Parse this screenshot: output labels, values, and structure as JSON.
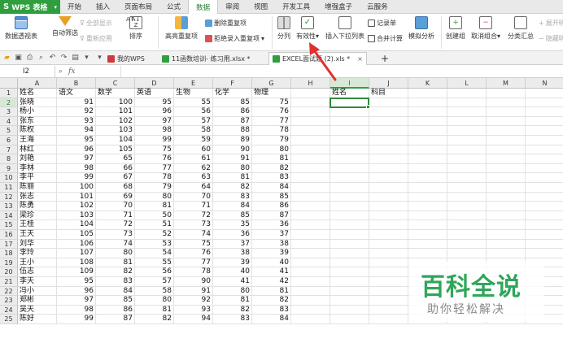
{
  "menubar": {
    "app_label": "WPS 表格",
    "tabs": [
      "开始",
      "插入",
      "页面布局",
      "公式",
      "数据",
      "审阅",
      "视图",
      "开发工具",
      "增强盒子",
      "云服务"
    ],
    "active_tab": "数据"
  },
  "ribbon": {
    "pivot": "数据透视表",
    "autofilter": "自动筛选",
    "show_all": "全部显示",
    "reapply": "重新应用",
    "sort": "排序",
    "highlight_dup": "高亮重复项",
    "delete_dup": "删除重复项",
    "reject_dup": "拒绝录入重复项",
    "split": "分列",
    "validity": "有效性",
    "insert_dropdown": "插入下拉列表",
    "record": "记录单",
    "merge_calc": "合并计算",
    "simulate": "模拟分析",
    "group": "创建组",
    "ungroup": "取消组合",
    "subtotal": "分类汇总",
    "show_detail": "展开明细",
    "hide_detail": "隐藏明细"
  },
  "doc_tabs": {
    "tabs": [
      {
        "label": "我的WPS",
        "closable": false
      },
      {
        "label": "11函数培训- 练习用.xlsx *",
        "closable": false
      },
      {
        "label": "EXCEL面试题 (2).xls *",
        "closable": true
      }
    ],
    "active_index": 2,
    "close_symbol": "×",
    "add_symbol": "+"
  },
  "formula_bar": {
    "cell_ref": "I2",
    "fx_label": "fx",
    "value": ""
  },
  "grid": {
    "columns": [
      "A",
      "B",
      "C",
      "D",
      "E",
      "F",
      "G",
      "H",
      "I",
      "J",
      "K",
      "L",
      "M",
      "N"
    ],
    "selected_column": "I",
    "selected_row": 2,
    "rows": [
      {
        "n": 1,
        "cells": [
          "姓名",
          "语文",
          "数学",
          "英语",
          "生物",
          "化学",
          "物理",
          "",
          "姓名",
          "科目"
        ]
      },
      {
        "n": 2,
        "cells": [
          "张晓",
          "91",
          "100",
          "95",
          "55",
          "85",
          "75"
        ]
      },
      {
        "n": 3,
        "cells": [
          "杨小",
          "92",
          "101",
          "96",
          "56",
          "86",
          "76"
        ]
      },
      {
        "n": 4,
        "cells": [
          "张东",
          "93",
          "102",
          "97",
          "57",
          "87",
          "77"
        ]
      },
      {
        "n": 5,
        "cells": [
          "陈权",
          "94",
          "103",
          "98",
          "58",
          "88",
          "78"
        ]
      },
      {
        "n": 6,
        "cells": [
          "王海",
          "95",
          "104",
          "99",
          "59",
          "89",
          "79"
        ]
      },
      {
        "n": 7,
        "cells": [
          "林红",
          "96",
          "105",
          "75",
          "60",
          "90",
          "80"
        ]
      },
      {
        "n": 8,
        "cells": [
          "刘艳",
          "97",
          "65",
          "76",
          "61",
          "91",
          "81"
        ]
      },
      {
        "n": 9,
        "cells": [
          "李林",
          "98",
          "66",
          "77",
          "62",
          "80",
          "82"
        ]
      },
      {
        "n": 10,
        "cells": [
          "李平",
          "99",
          "67",
          "78",
          "63",
          "81",
          "83"
        ]
      },
      {
        "n": 11,
        "cells": [
          "陈丽",
          "100",
          "68",
          "79",
          "64",
          "82",
          "84"
        ]
      },
      {
        "n": 12,
        "cells": [
          "张志",
          "101",
          "69",
          "80",
          "70",
          "83",
          "85"
        ]
      },
      {
        "n": 13,
        "cells": [
          "陈勇",
          "102",
          "70",
          "81",
          "71",
          "84",
          "86"
        ]
      },
      {
        "n": 14,
        "cells": [
          "梁珍",
          "103",
          "71",
          "50",
          "72",
          "85",
          "87"
        ]
      },
      {
        "n": 15,
        "cells": [
          "王桂",
          "104",
          "72",
          "51",
          "73",
          "35",
          "36"
        ]
      },
      {
        "n": 16,
        "cells": [
          "王天",
          "105",
          "73",
          "52",
          "74",
          "36",
          "37"
        ]
      },
      {
        "n": 17,
        "cells": [
          "刘华",
          "106",
          "74",
          "53",
          "75",
          "37",
          "38"
        ]
      },
      {
        "n": 18,
        "cells": [
          "李玲",
          "107",
          "80",
          "54",
          "76",
          "38",
          "39"
        ]
      },
      {
        "n": 19,
        "cells": [
          "王小",
          "108",
          "81",
          "55",
          "77",
          "39",
          "40"
        ]
      },
      {
        "n": 20,
        "cells": [
          "伍志",
          "109",
          "82",
          "56",
          "78",
          "40",
          "41"
        ]
      },
      {
        "n": 21,
        "cells": [
          "李天",
          "95",
          "83",
          "57",
          "90",
          "41",
          "42"
        ]
      },
      {
        "n": 22,
        "cells": [
          "冯小",
          "96",
          "84",
          "58",
          "91",
          "80",
          "81"
        ]
      },
      {
        "n": 23,
        "cells": [
          "郑彬",
          "97",
          "85",
          "80",
          "92",
          "81",
          "82"
        ]
      },
      {
        "n": 24,
        "cells": [
          "吴天",
          "98",
          "86",
          "81",
          "93",
          "82",
          "83"
        ]
      },
      {
        "n": 25,
        "cells": [
          "陈好",
          "99",
          "87",
          "82",
          "94",
          "83",
          "84"
        ]
      }
    ]
  },
  "watermark": {
    "title": "百科全说",
    "subtitle": "助你轻松解决"
  },
  "colors": {
    "accent": "#2f9e3f",
    "arrow": "#e03030"
  }
}
